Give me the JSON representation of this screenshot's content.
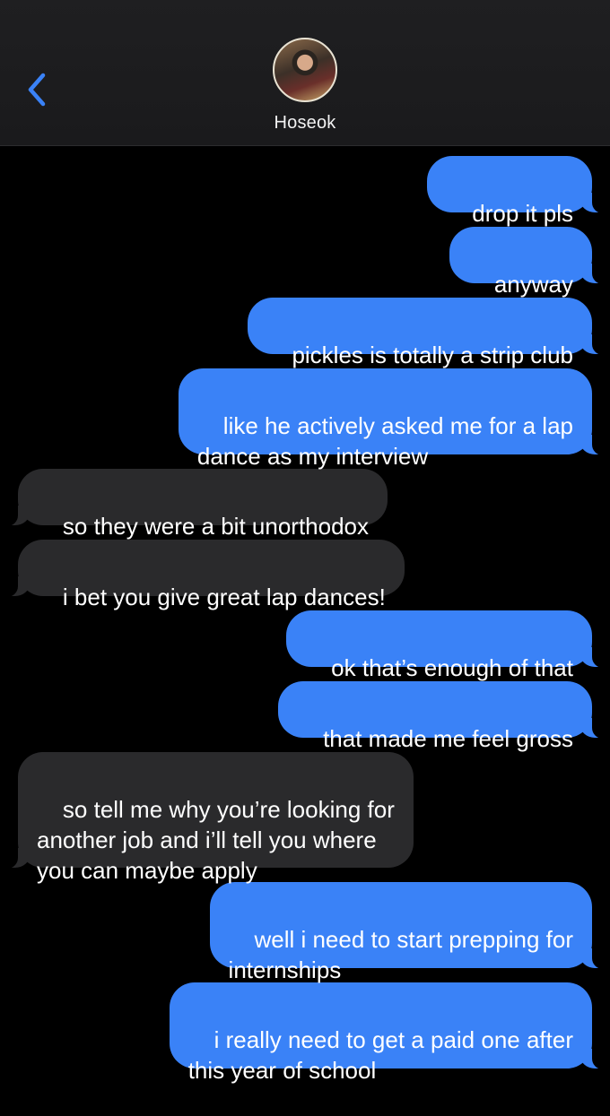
{
  "header": {
    "contact_name": "Hoseok",
    "back_icon": "chevron-left-icon",
    "accent_color": "#3a82f7"
  },
  "messages": [
    {
      "from": "me",
      "text": "drop it pls"
    },
    {
      "from": "me",
      "text": "anyway"
    },
    {
      "from": "me",
      "text": "pickles is totally a strip club"
    },
    {
      "from": "me",
      "text": "like he actively asked me for a lap\ndance as my interview"
    },
    {
      "from": "them",
      "text": "so they were a bit unorthodox"
    },
    {
      "from": "them",
      "text": "i bet you give great lap dances!"
    },
    {
      "from": "me",
      "text": "ok that’s enough of that"
    },
    {
      "from": "me",
      "text": "that made me feel gross"
    },
    {
      "from": "them",
      "text": "so tell me why you’re looking for\nanother job and i’ll tell you where\nyou can maybe apply"
    },
    {
      "from": "me",
      "text": "well i need to start prepping for\ninternships"
    },
    {
      "from": "me",
      "text": "i really need to get a paid one after\nthis year of school"
    }
  ]
}
